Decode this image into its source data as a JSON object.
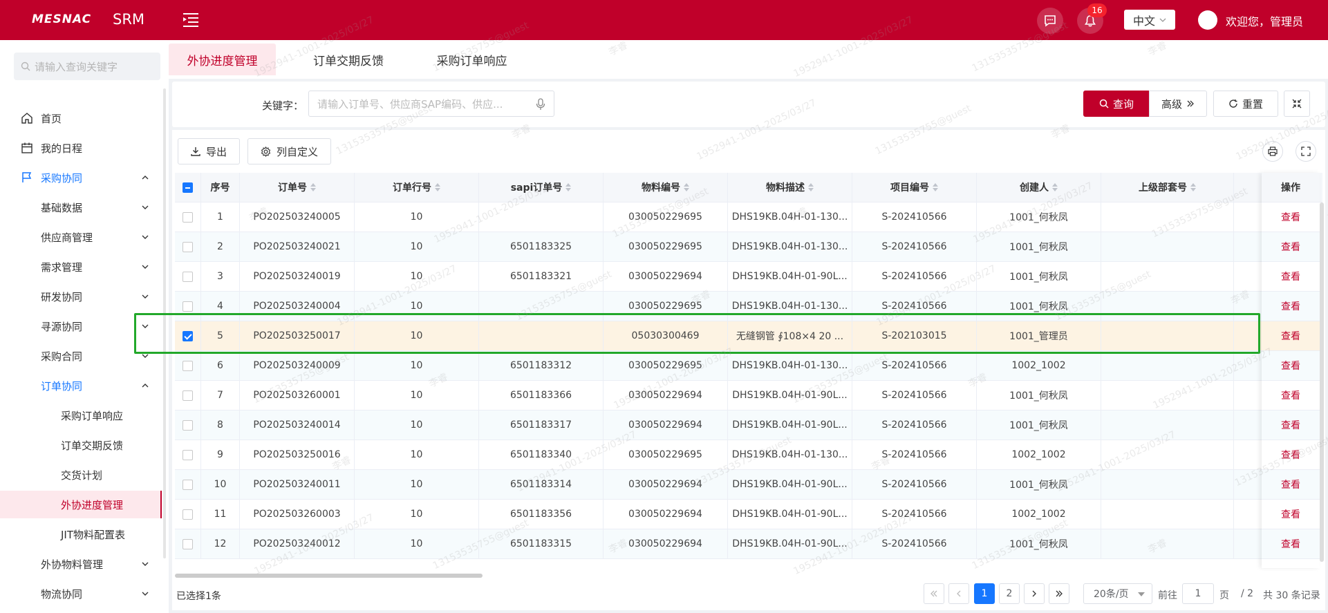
{
  "header": {
    "logo": "MESNAC",
    "product": "SRM",
    "notification_count": "16",
    "language": "中文",
    "welcome": "欢迎您，管理员"
  },
  "sidebar": {
    "search_placeholder": "请输入查询关键字",
    "items": [
      {
        "label": "首页",
        "icon": "home-icon"
      },
      {
        "label": "我的日程",
        "icon": "calendar-icon"
      },
      {
        "label": "采购协同",
        "icon": "flag-icon"
      },
      {
        "label": "基础数据"
      },
      {
        "label": "供应商管理"
      },
      {
        "label": "需求管理"
      },
      {
        "label": "研发协同"
      },
      {
        "label": "寻源协同"
      },
      {
        "label": "采购合同"
      },
      {
        "label": "订单协同"
      },
      {
        "label": "采购订单响应"
      },
      {
        "label": "订单交期反馈"
      },
      {
        "label": "交货计划"
      },
      {
        "label": "外协进度管理"
      },
      {
        "label": "JIT物料配置表"
      },
      {
        "label": "外协物料管理"
      },
      {
        "label": "物流协同"
      }
    ]
  },
  "tabs": [
    "外协进度管理",
    "订单交期反馈",
    "采购订单响应"
  ],
  "search": {
    "keyword_label": "关键字：",
    "keyword_placeholder": "请输入订单号、供应商SAP编码、供应...",
    "query_label": "查询",
    "advanced_label": "高级",
    "reset_label": "重置"
  },
  "toolbar": {
    "export_label": "导出",
    "columns_label": "列自定义"
  },
  "table": {
    "columns": [
      "序号",
      "订单号",
      "订单行号",
      "sapi订单号",
      "物料编号",
      "物料描述",
      "项目编号",
      "创建人",
      "上级部套号",
      "操作"
    ],
    "action_label": "查看",
    "rows": [
      {
        "no": "1",
        "order": "PO202503240005",
        "line": "10",
        "sap": "",
        "material": "030050229695",
        "desc": "DHS19KB.04H-01-130...",
        "project": "S-202410566",
        "creator": "1001_何秋凤",
        "parent": "",
        "checked": false
      },
      {
        "no": "2",
        "order": "PO202503240021",
        "line": "10",
        "sap": "6501183325",
        "material": "030050229695",
        "desc": "DHS19KB.04H-01-130...",
        "project": "S-202410566",
        "creator": "1001_何秋凤",
        "parent": "",
        "checked": false
      },
      {
        "no": "3",
        "order": "PO202503240019",
        "line": "10",
        "sap": "6501183321",
        "material": "030050229694",
        "desc": "DHS19KB.04H-01-90L...",
        "project": "S-202410566",
        "creator": "1001_何秋凤",
        "parent": "",
        "checked": false
      },
      {
        "no": "4",
        "order": "PO202503240004",
        "line": "10",
        "sap": "",
        "material": "030050229695",
        "desc": "DHS19KB.04H-01-130...",
        "project": "S-202410566",
        "creator": "1001_何秋凤",
        "parent": "",
        "checked": false
      },
      {
        "no": "5",
        "order": "PO202503250017",
        "line": "10",
        "sap": "",
        "material": "05030300469",
        "desc": "无缝钢管 ∮108×4 20 ...",
        "project": "S-202103015",
        "creator": "1001_管理员",
        "parent": "",
        "checked": true
      },
      {
        "no": "6",
        "order": "PO202503240009",
        "line": "10",
        "sap": "6501183312",
        "material": "030050229695",
        "desc": "DHS19KB.04H-01-130...",
        "project": "S-202410566",
        "creator": "1002_1002",
        "parent": "",
        "checked": false
      },
      {
        "no": "7",
        "order": "PO202503260001",
        "line": "10",
        "sap": "6501183366",
        "material": "030050229694",
        "desc": "DHS19KB.04H-01-90L...",
        "project": "S-202410566",
        "creator": "1001_何秋凤",
        "parent": "",
        "checked": false
      },
      {
        "no": "8",
        "order": "PO202503240014",
        "line": "10",
        "sap": "6501183317",
        "material": "030050229694",
        "desc": "DHS19KB.04H-01-90L...",
        "project": "S-202410566",
        "creator": "1001_何秋凤",
        "parent": "",
        "checked": false
      },
      {
        "no": "9",
        "order": "PO202503250016",
        "line": "10",
        "sap": "6501183340",
        "material": "030050229695",
        "desc": "DHS19KB.04H-01-130...",
        "project": "S-202410566",
        "creator": "1002_1002",
        "parent": "",
        "checked": false
      },
      {
        "no": "10",
        "order": "PO202503240011",
        "line": "10",
        "sap": "6501183314",
        "material": "030050229694",
        "desc": "DHS19KB.04H-01-90L...",
        "project": "S-202410566",
        "creator": "1001_何秋凤",
        "parent": "",
        "checked": false
      },
      {
        "no": "11",
        "order": "PO202503260003",
        "line": "10",
        "sap": "6501183356",
        "material": "030050229694",
        "desc": "DHS19KB.04H-01-90L...",
        "project": "S-202410566",
        "creator": "1002_1002",
        "parent": "",
        "checked": false
      },
      {
        "no": "12",
        "order": "PO202503240012",
        "line": "10",
        "sap": "6501183315",
        "material": "030050229694",
        "desc": "DHS19KB.04H-01-90L...",
        "project": "S-202410566",
        "creator": "1001_何秋凤",
        "parent": "",
        "checked": false
      }
    ]
  },
  "footer": {
    "selected_text": "已选择1条",
    "pages": [
      "1",
      "2"
    ],
    "current_page": "1",
    "page_size": "20条/页",
    "goto_label": "前往",
    "goto_value": "1",
    "page_unit": "页",
    "total_pages": "/ 2",
    "total_records": "共 30 条记录"
  },
  "watermark": [
    "1952941-1001-2025/03/27",
    "13153535755@guest",
    "李睿"
  ]
}
